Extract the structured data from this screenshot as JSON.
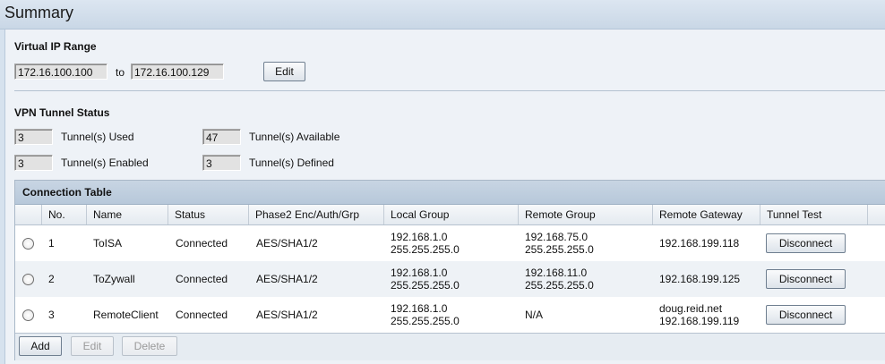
{
  "page_title": "Summary",
  "virtual_ip": {
    "label": "Virtual IP Range",
    "start": "172.16.100.100",
    "to_label": "to",
    "end": "172.16.100.129",
    "edit_label": "Edit"
  },
  "vpn_status": {
    "label": "VPN Tunnel Status",
    "used_value": "3",
    "used_label": "Tunnel(s) Used",
    "available_value": "47",
    "available_label": "Tunnel(s) Available",
    "enabled_value": "3",
    "enabled_label": "Tunnel(s) Enabled",
    "defined_value": "3",
    "defined_label": "Tunnel(s) Defined"
  },
  "connection_table": {
    "caption": "Connection Table",
    "headers": [
      "No.",
      "Name",
      "Status",
      "Phase2 Enc/Auth/Grp",
      "Local Group",
      "Remote Group",
      "Remote Gateway",
      "Tunnel Test"
    ],
    "rows": [
      {
        "no": "1",
        "name": "ToISA",
        "status": "Connected",
        "phase2": "AES/SHA1/2",
        "local1": "192.168.1.0",
        "local2": "255.255.255.0",
        "remote1": "192.168.75.0",
        "remote2": "255.255.255.0",
        "gw1": "192.168.199.118",
        "gw2": "",
        "action": "Disconnect"
      },
      {
        "no": "2",
        "name": "ToZywall",
        "status": "Connected",
        "phase2": "AES/SHA1/2",
        "local1": "192.168.1.0",
        "local2": "255.255.255.0",
        "remote1": "192.168.11.0",
        "remote2": "255.255.255.0",
        "gw1": "192.168.199.125",
        "gw2": "",
        "action": "Disconnect"
      },
      {
        "no": "3",
        "name": "RemoteClient",
        "status": "Connected",
        "phase2": "AES/SHA1/2",
        "local1": "192.168.1.0",
        "local2": "255.255.255.0",
        "remote1": "N/A",
        "remote2": "",
        "gw1": "doug.reid.net",
        "gw2": "192.168.199.119",
        "action": "Disconnect"
      }
    ],
    "add_label": "Add",
    "edit_label": "Edit",
    "delete_label": "Delete"
  }
}
